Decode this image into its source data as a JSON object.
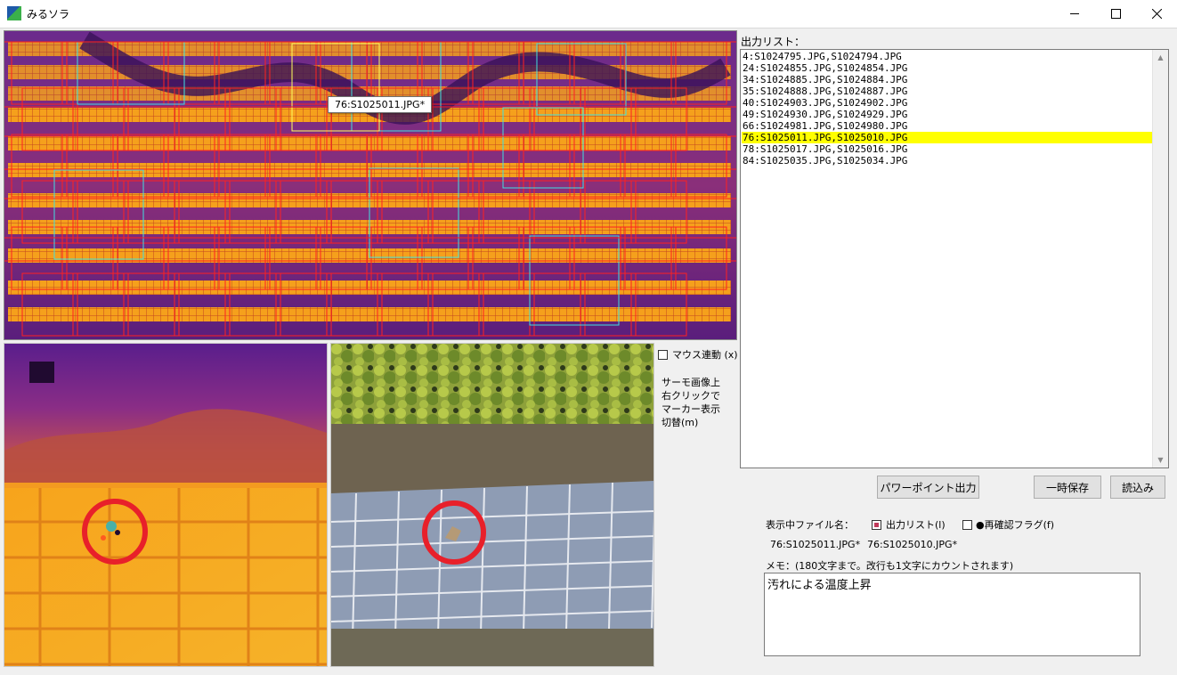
{
  "window": {
    "title": "みるソラ",
    "icons": {
      "app": "app-icon",
      "minimize": "minimize-icon",
      "maximize": "maximize-icon",
      "close": "close-icon"
    }
  },
  "overview": {
    "tooltip": "76:S1025011.JPG*"
  },
  "mouse_link": {
    "label": "マウス連動 (x)",
    "checked": false
  },
  "note": "サーモ画像上\n右クリックで\nマーカー表示\n切替(m)",
  "output_list": {
    "label": "出力リスト：",
    "items": [
      "4:S1024795.JPG,S1024794.JPG",
      "24:S1024855.JPG,S1024854.JPG",
      "34:S1024885.JPG,S1024884.JPG",
      "35:S1024888.JPG,S1024887.JPG",
      "40:S1024903.JPG,S1024902.JPG",
      "49:S1024930.JPG,S1024929.JPG",
      "66:S1024981.JPG,S1024980.JPG",
      "76:S1025011.JPG,S1025010.JPG",
      "78:S1025017.JPG,S1025016.JPG",
      "84:S1025035.JPG,S1025034.JPG"
    ],
    "selected_index": 7
  },
  "buttons": {
    "powerpoint": "パワーポイント出力",
    "temp_save": "一時保存",
    "load": "読込み"
  },
  "display": {
    "label": "表示中ファイル名：",
    "output_list_check": {
      "label": "出力リスト(l)",
      "checked": true
    },
    "recheck_flag": {
      "label": "●再確認フラグ(f)",
      "checked": false
    },
    "thermal_file": "76:S1025011.JPG*",
    "visual_file": "76:S1025010.JPG*"
  },
  "memo": {
    "label": "メモ：(180文字まで。改行も1文字にカウントされます)",
    "value": "汚れによる温度上昇"
  },
  "colors": {
    "selection": "#ffff00",
    "marker": "#e8202a",
    "grid_red": "#ff2020",
    "grid_cyan": "#40e0e0",
    "grid_yellow": "#ffff60",
    "thermal_hot": "#f7a21b",
    "thermal_cool": "#5a1e8c"
  }
}
